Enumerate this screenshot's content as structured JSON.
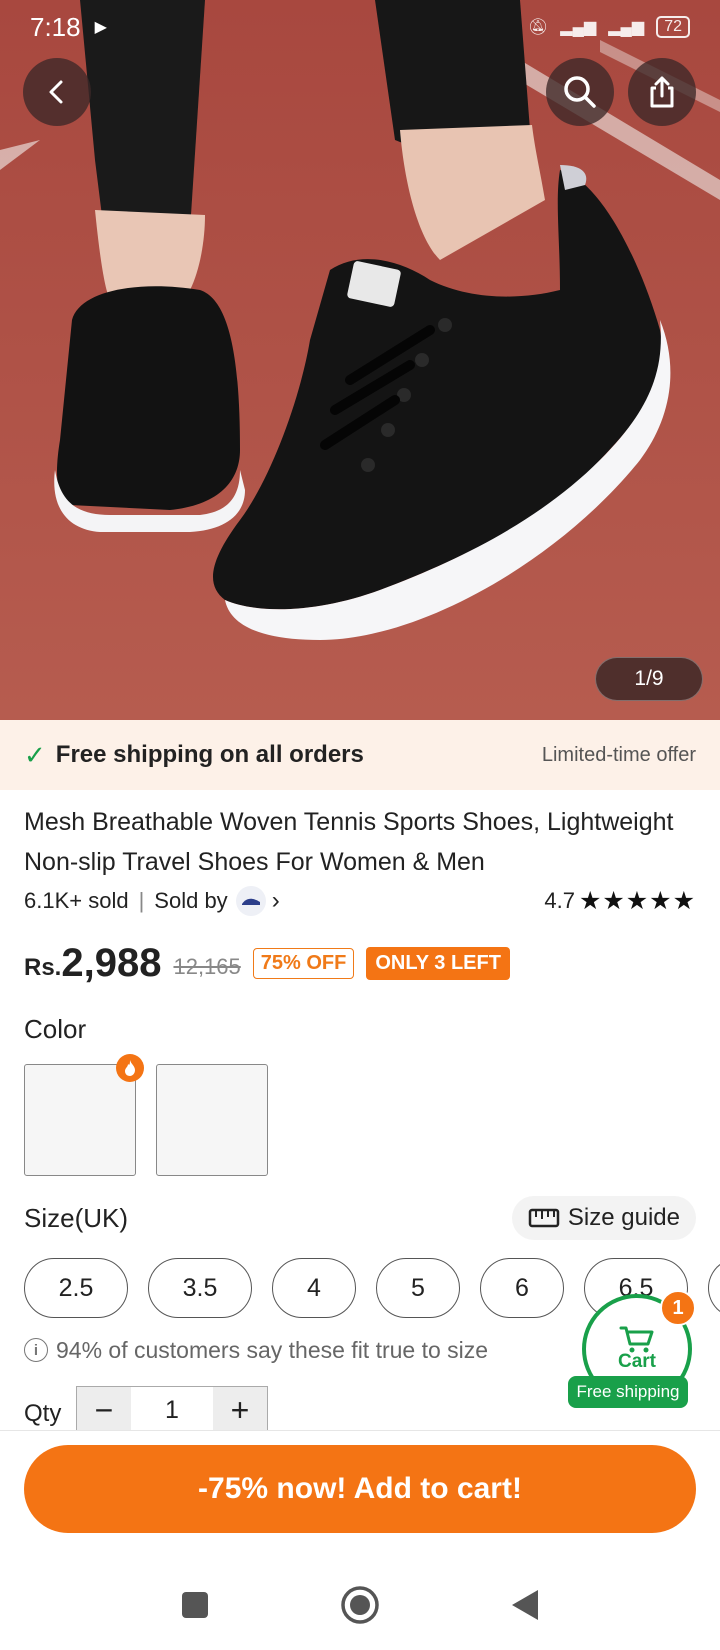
{
  "status_bar": {
    "time": "7:18",
    "battery": "72"
  },
  "gallery": {
    "counter": "1/9"
  },
  "shipping_banner": {
    "text": "Free shipping on all orders",
    "offer": "Limited-time offer"
  },
  "product": {
    "title": "Mesh Breathable Woven Tennis Sports Shoes, Lightweight Non-slip Travel Shoes For Women & Men",
    "sold": "6.1K+ sold",
    "separator": "|",
    "sold_by_label": "Sold by",
    "rating": "4.7",
    "rating_value": 4.7,
    "stars": "★★★★★"
  },
  "price": {
    "currency": "Rs.",
    "amount": "2,988",
    "original": "12,165",
    "discount_badge": "75% OFF",
    "stock_badge": "ONLY 3 LEFT"
  },
  "color": {
    "label": "Color",
    "swatches": 2
  },
  "size": {
    "label": "Size(UK)",
    "guide_label": "Size guide",
    "options": [
      "2.5",
      "3.5",
      "4",
      "5",
      "6",
      "6.5"
    ],
    "fit_note": "94% of customers say these fit true to size"
  },
  "quantity": {
    "label": "Qty",
    "value": "1",
    "minus": "−",
    "plus": "+"
  },
  "cart_float": {
    "label": "Cart",
    "count": "1",
    "free_shipping": "Free shipping"
  },
  "cta": {
    "label": "-75% now! Add to cart!"
  },
  "colors": {
    "accent": "#f47414",
    "green": "#19a04a"
  }
}
